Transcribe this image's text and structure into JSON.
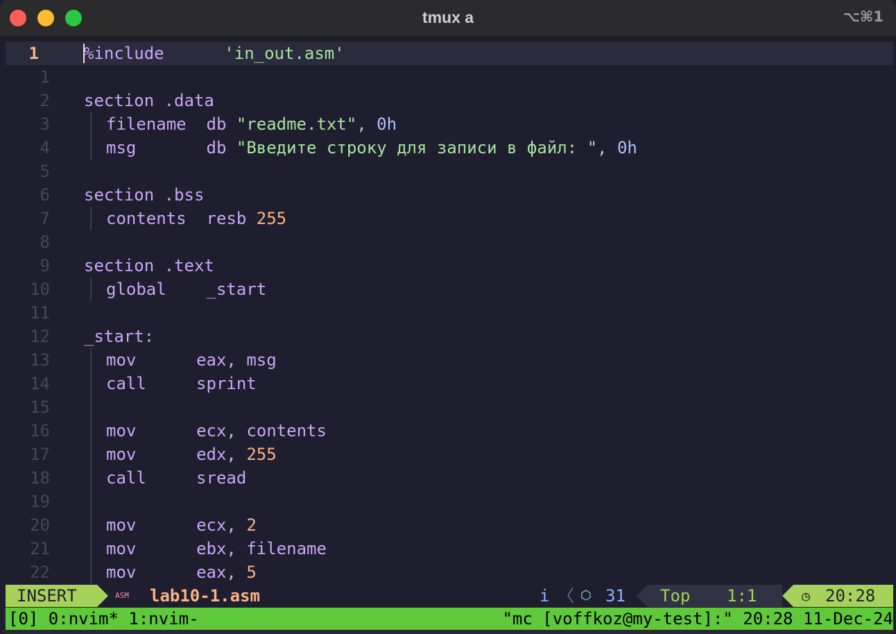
{
  "window": {
    "title": "tmux a",
    "shortcut": "⌥⌘1"
  },
  "editor": {
    "current_line_number": "1",
    "include_directive": "%include",
    "include_file": "'in_out.asm'",
    "lines": [
      {
        "n": "1"
      },
      {
        "n": "2",
        "kw1": "section",
        "arg": ".data"
      },
      {
        "n": "3",
        "label": "filename",
        "op": "db",
        "str": "\"readme.txt\"",
        "comma": ",",
        "num": "0h"
      },
      {
        "n": "4",
        "label": "msg",
        "op": "db",
        "str": "\"Введите строку для записи в файл: \"",
        "comma": ",",
        "num": "0h"
      },
      {
        "n": "5"
      },
      {
        "n": "6",
        "kw1": "section",
        "arg": ".bss"
      },
      {
        "n": "7",
        "label": "contents",
        "op": "resb",
        "num": "255"
      },
      {
        "n": "8"
      },
      {
        "n": "9",
        "kw1": "section",
        "arg": ".text"
      },
      {
        "n": "10",
        "label": "global",
        "arg": "_start"
      },
      {
        "n": "11"
      },
      {
        "n": "12",
        "label": "_start:"
      },
      {
        "n": "13",
        "op": "mov",
        "a": "eax",
        "comma": ",",
        "b": "msg"
      },
      {
        "n": "14",
        "op": "call",
        "a": "sprint"
      },
      {
        "n": "15"
      },
      {
        "n": "16",
        "op": "mov",
        "a": "ecx",
        "comma": ",",
        "b": "contents"
      },
      {
        "n": "17",
        "op": "mov",
        "a": "edx",
        "comma": ",",
        "b": "255"
      },
      {
        "n": "18",
        "op": "call",
        "a": "sread"
      },
      {
        "n": "19"
      },
      {
        "n": "20",
        "op": "mov",
        "a": "ecx",
        "comma": ",",
        "b": "2"
      },
      {
        "n": "21",
        "op": "mov",
        "a": "ebx",
        "comma": ",",
        "b": "filename"
      },
      {
        "n": "22",
        "op": "mov",
        "a": "eax",
        "comma": ",",
        "b": "5"
      }
    ]
  },
  "statusline": {
    "mode": "INSERT",
    "filetype_icon": "ASM",
    "filename": "lab10-1.asm",
    "lsp_indicator": "i",
    "separator": "〈",
    "package_icon": "⬡",
    "word_count": "31",
    "scroll": "Top",
    "cursor": "1:1",
    "clock_icon": "◷",
    "time": "20:28"
  },
  "tmux": {
    "left": "[0] 0:nvim* 1:nvim-",
    "right": "\"mc [voffkoz@my-test]:\" 20:28 11-Dec-24"
  },
  "colors": {
    "background": "#1e1e2e",
    "keyword": "#cba6f7",
    "string": "#a6e3a1",
    "number": "#fab387",
    "mode_bg": "#a6d15a",
    "tmux_bg": "#5fc93b"
  }
}
